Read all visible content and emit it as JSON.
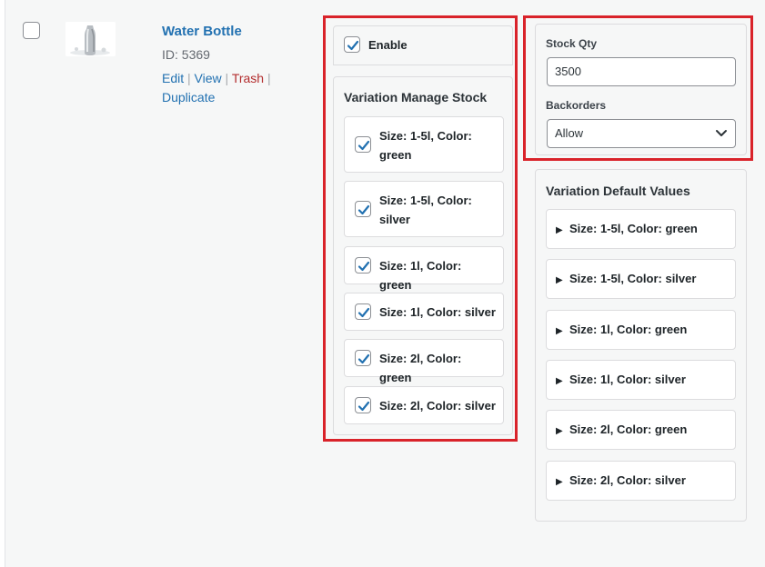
{
  "product": {
    "name": "Water Bottle",
    "id_text": "ID: 5369",
    "actions": {
      "edit": "Edit",
      "view": "View",
      "trash": "Trash",
      "duplicate": "Duplicate",
      "separator": "|"
    }
  },
  "enable": {
    "label": "Enable",
    "checked": true
  },
  "manage_stock": {
    "title": "Variation Manage Stock",
    "items": [
      {
        "label": "Size: 1-5l, Color: green",
        "checked": true
      },
      {
        "label": "Size: 1-5l, Color: silver",
        "checked": true
      },
      {
        "label": "Size: 1l, Color: green",
        "checked": true
      },
      {
        "label": "Size: 1l, Color: silver",
        "checked": true
      },
      {
        "label": "Size: 2l, Color: green",
        "checked": true
      },
      {
        "label": "Size: 2l, Color: silver",
        "checked": true
      }
    ]
  },
  "stock": {
    "qty_label": "Stock Qty",
    "qty_value": "3500",
    "backorders_label": "Backorders",
    "backorders_value": "Allow"
  },
  "defaults": {
    "title": "Variation Default Values",
    "items": [
      "Size: 1-5l, Color: green",
      "Size: 1-5l, Color: silver",
      "Size: 1l, Color: green",
      "Size: 1l, Color: silver",
      "Size: 2l, Color: green",
      "Size: 2l, Color: silver"
    ]
  },
  "colors": {
    "link": "#2271b1",
    "trash": "#b32d2e",
    "highlight": "#d9232a",
    "check": "#2271b1"
  }
}
